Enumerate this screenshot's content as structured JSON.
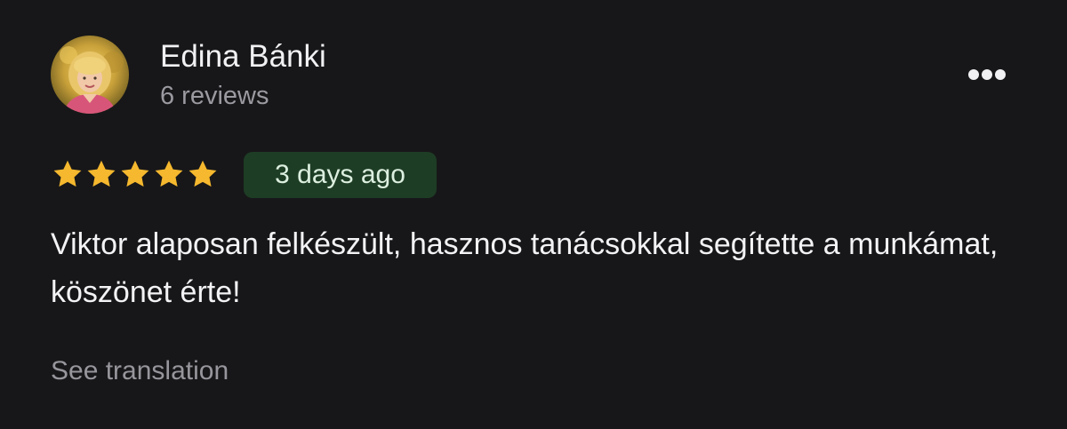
{
  "reviewer": {
    "name": "Edina Bánki",
    "review_count": "6 reviews",
    "avatar": "reviewer-profile-photo"
  },
  "menu": {
    "icon": "more-horizontal-icon"
  },
  "rating": {
    "stars": 5,
    "max_stars": 5,
    "star_color": "#f5b82e",
    "icon": "star-icon"
  },
  "date_badge": {
    "label": "3 days ago",
    "background": "#1e3d25"
  },
  "review": {
    "text": "Viktor alaposan felkészült, hasznos tanácsokkal segítette a munkámat, köszönet érte!"
  },
  "actions": {
    "see_translation": "See translation"
  },
  "colors": {
    "background": "#171719",
    "primary_text": "#f1f1f3",
    "secondary_text": "#9a9aa0"
  }
}
